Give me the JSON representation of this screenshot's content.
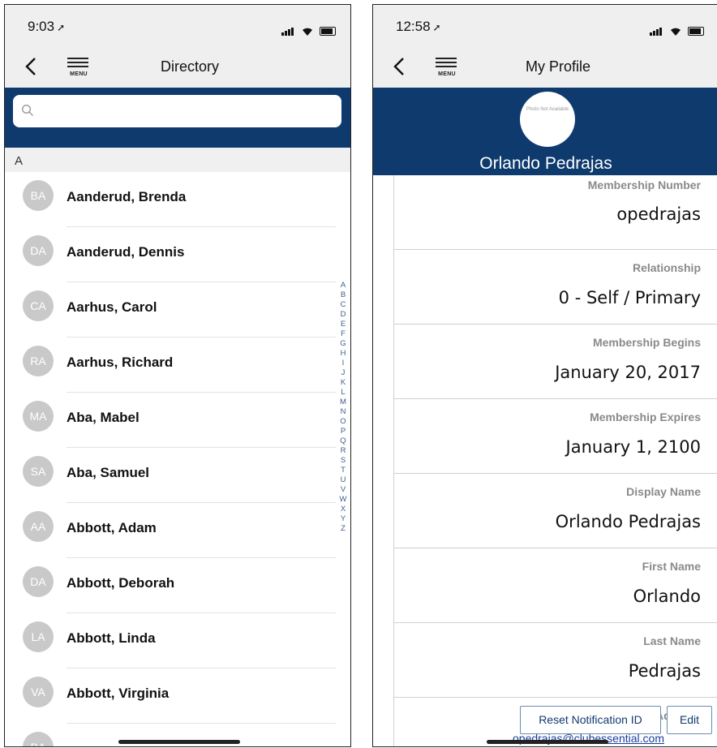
{
  "left": {
    "status": {
      "time": "9:03"
    },
    "nav": {
      "title": "Directory",
      "menu_label": "MENU"
    },
    "search": {
      "placeholder": ""
    },
    "section": "A",
    "contacts": [
      {
        "initials": "BA",
        "name": "Aanderud, Brenda"
      },
      {
        "initials": "DA",
        "name": "Aanderud, Dennis"
      },
      {
        "initials": "CA",
        "name": "Aarhus, Carol"
      },
      {
        "initials": "RA",
        "name": "Aarhus, Richard"
      },
      {
        "initials": "MA",
        "name": "Aba, Mabel"
      },
      {
        "initials": "SA",
        "name": "Aba, Samuel"
      },
      {
        "initials": "AA",
        "name": "Abbott, Adam"
      },
      {
        "initials": "DA",
        "name": "Abbott, Deborah"
      },
      {
        "initials": "LA",
        "name": "Abbott, Linda"
      },
      {
        "initials": "VA",
        "name": "Abbott, Virginia"
      },
      {
        "initials": "BA",
        "name": ""
      }
    ],
    "index_letters": [
      "A",
      "B",
      "C",
      "D",
      "E",
      "F",
      "G",
      "H",
      "I",
      "J",
      "K",
      "L",
      "M",
      "N",
      "O",
      "P",
      "Q",
      "R",
      "S",
      "T",
      "U",
      "V",
      "W",
      "X",
      "Y",
      "Z"
    ]
  },
  "right": {
    "status": {
      "time": "12:58"
    },
    "nav": {
      "title": "My Profile",
      "menu_label": "MENU"
    },
    "profile": {
      "photo_text": "Photo Not Available",
      "name": "Orlando Pedrajas"
    },
    "fields": [
      {
        "label": "Membership Number",
        "value": "opedrajas"
      },
      {
        "label": "Relationship",
        "value": "0 - Self / Primary"
      },
      {
        "label": "Membership Begins",
        "value": "January 20, 2017"
      },
      {
        "label": "Membership Expires",
        "value": "January 1, 2100"
      },
      {
        "label": "Display Name",
        "value": "Orlando Pedrajas"
      },
      {
        "label": "First Name",
        "value": "Orlando"
      },
      {
        "label": "Last Name",
        "value": "Pedrajas"
      },
      {
        "label": "Primary Email Address",
        "value": "opedrajas@clubessential.com"
      }
    ],
    "buttons": {
      "reset": "Reset Notification ID",
      "edit": "Edit"
    }
  },
  "colors": {
    "header_blue": "#0e3a6e",
    "avatar_gray": "#c9c9c9",
    "link_blue": "#1a3a9a"
  }
}
